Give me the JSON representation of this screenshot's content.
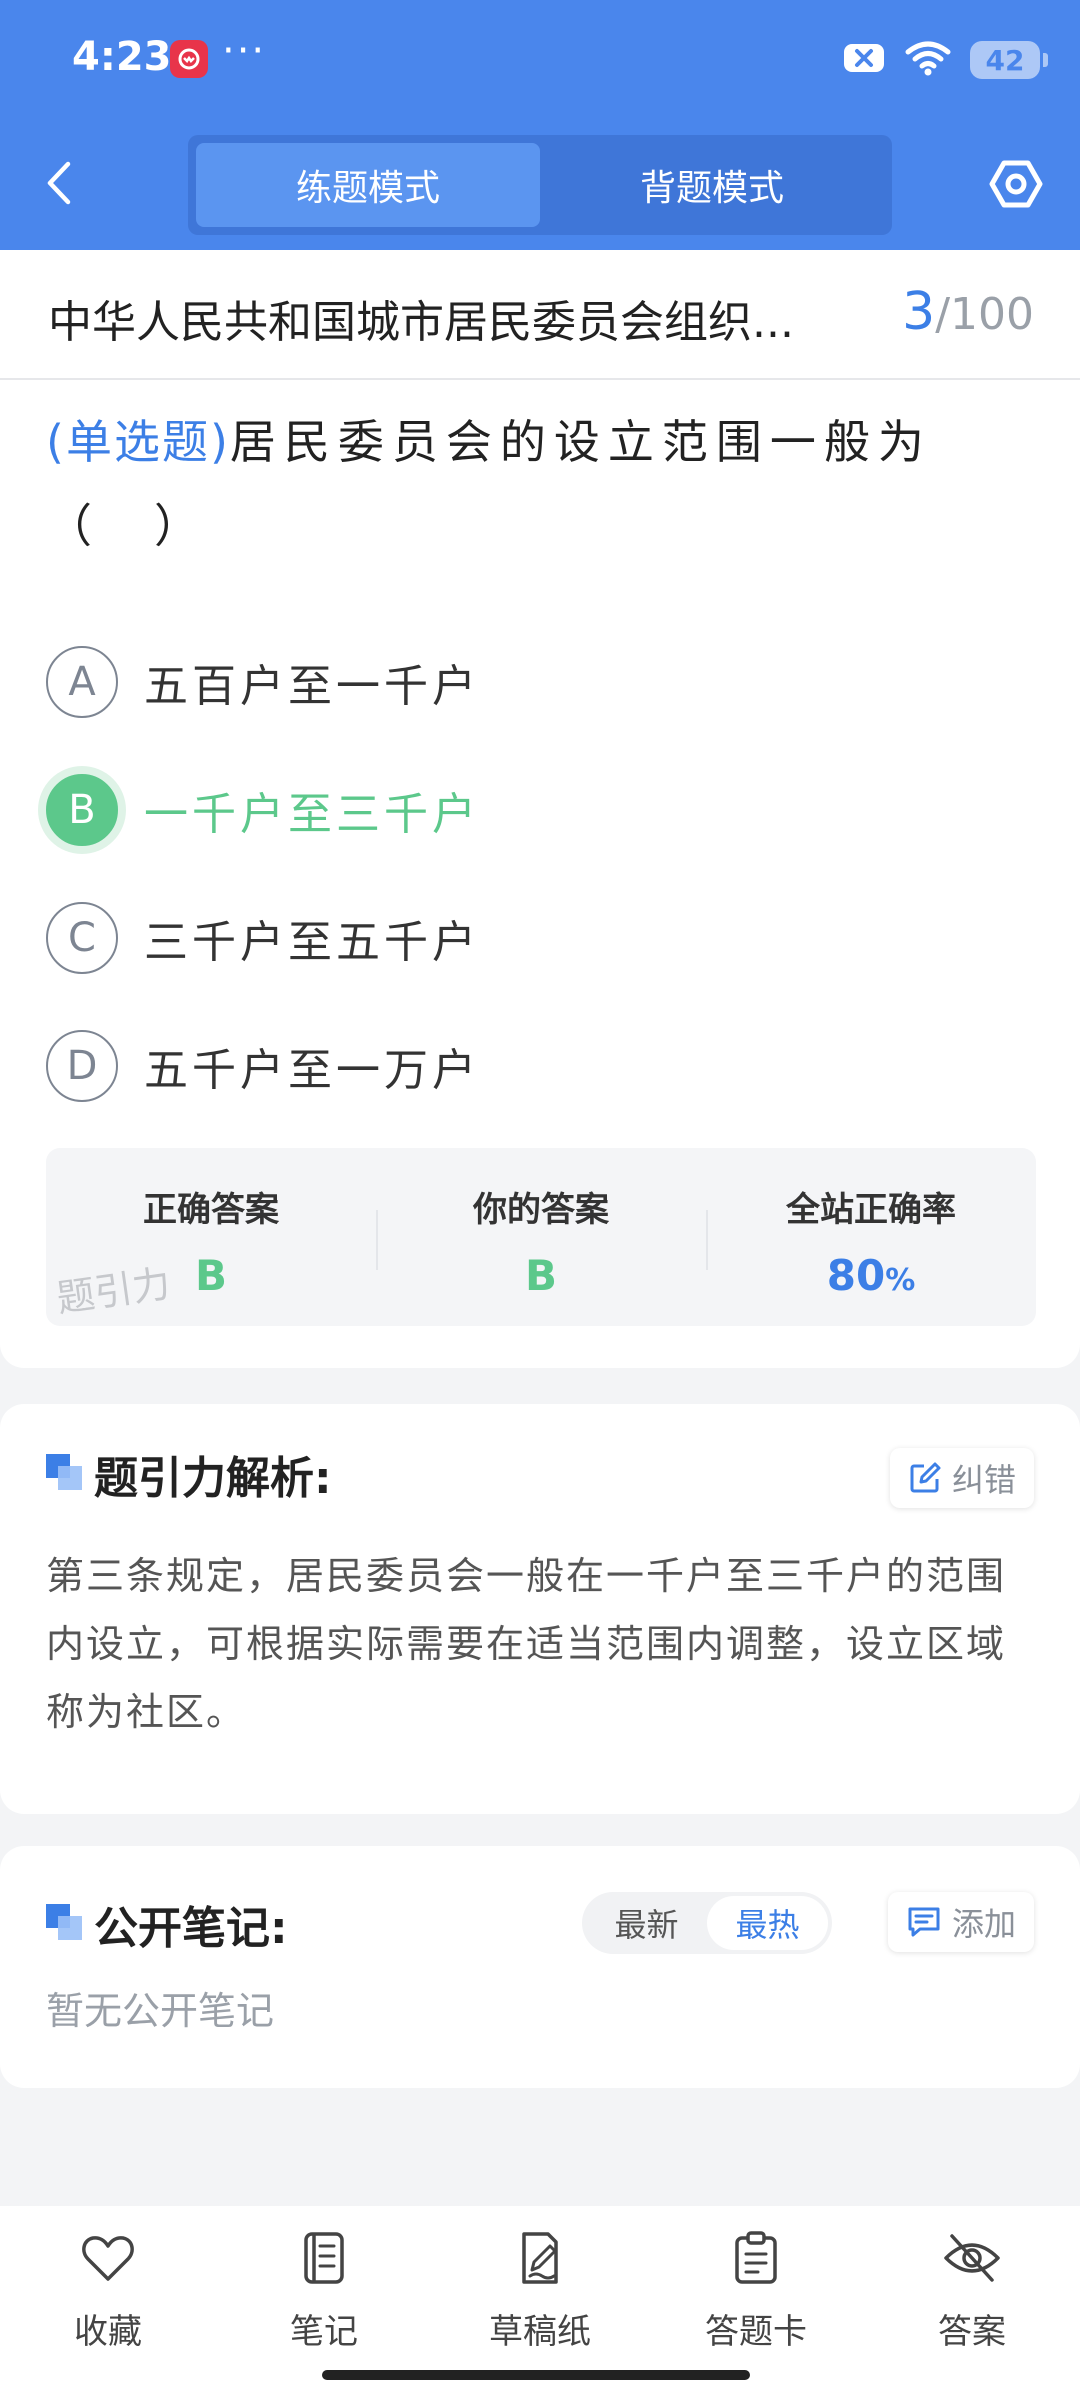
{
  "status_bar": {
    "time": "4:23",
    "dots": "···",
    "battery": "42"
  },
  "header": {
    "tabs": [
      {
        "label": "练题模式",
        "active": true
      },
      {
        "label": "背题模式",
        "active": false
      }
    ]
  },
  "title_row": {
    "title": "中华人民共和国城市居民委员会组织...",
    "current": "3",
    "total": "/100"
  },
  "question": {
    "type": "(单选题)",
    "text": "居民委员会的设立范围一般为（　）"
  },
  "options": [
    {
      "letter": "A",
      "text": "五百户至一千户",
      "state": "normal"
    },
    {
      "letter": "B",
      "text": "一千户至三千户",
      "state": "correct"
    },
    {
      "letter": "C",
      "text": "三千户至五千户",
      "state": "normal"
    },
    {
      "letter": "D",
      "text": "五千户至一万户",
      "state": "normal"
    }
  ],
  "answer_summary": {
    "correct_label": "正确答案",
    "correct_value": "B",
    "yours_label": "你的答案",
    "yours_value": "B",
    "rate_label": "全站正确率",
    "rate_value": "80",
    "rate_unit": "%",
    "watermark": "题引力"
  },
  "analysis": {
    "title": "题引力解析:",
    "report_label": "纠错",
    "text": "第三条规定，居民委员会一般在一千户至三千户的范围内设立，可根据实际需要在适当范围内调整，设立区域称为社区。"
  },
  "notes": {
    "title": "公开笔记:",
    "sort_newest": "最新",
    "sort_hottest": "最热",
    "add_label": "添加",
    "empty_text": "暂无公开笔记"
  },
  "bottom_bar": [
    {
      "label": "收藏",
      "icon": "heart-icon"
    },
    {
      "label": "笔记",
      "icon": "notebook-icon"
    },
    {
      "label": "草稿纸",
      "icon": "draft-icon"
    },
    {
      "label": "答题卡",
      "icon": "clipboard-icon"
    },
    {
      "label": "答案",
      "icon": "eye-off-icon"
    }
  ],
  "colors": {
    "primary": "#4a86ec",
    "accent_blue": "#3c7fe6",
    "correct_green": "#5cc88b"
  }
}
